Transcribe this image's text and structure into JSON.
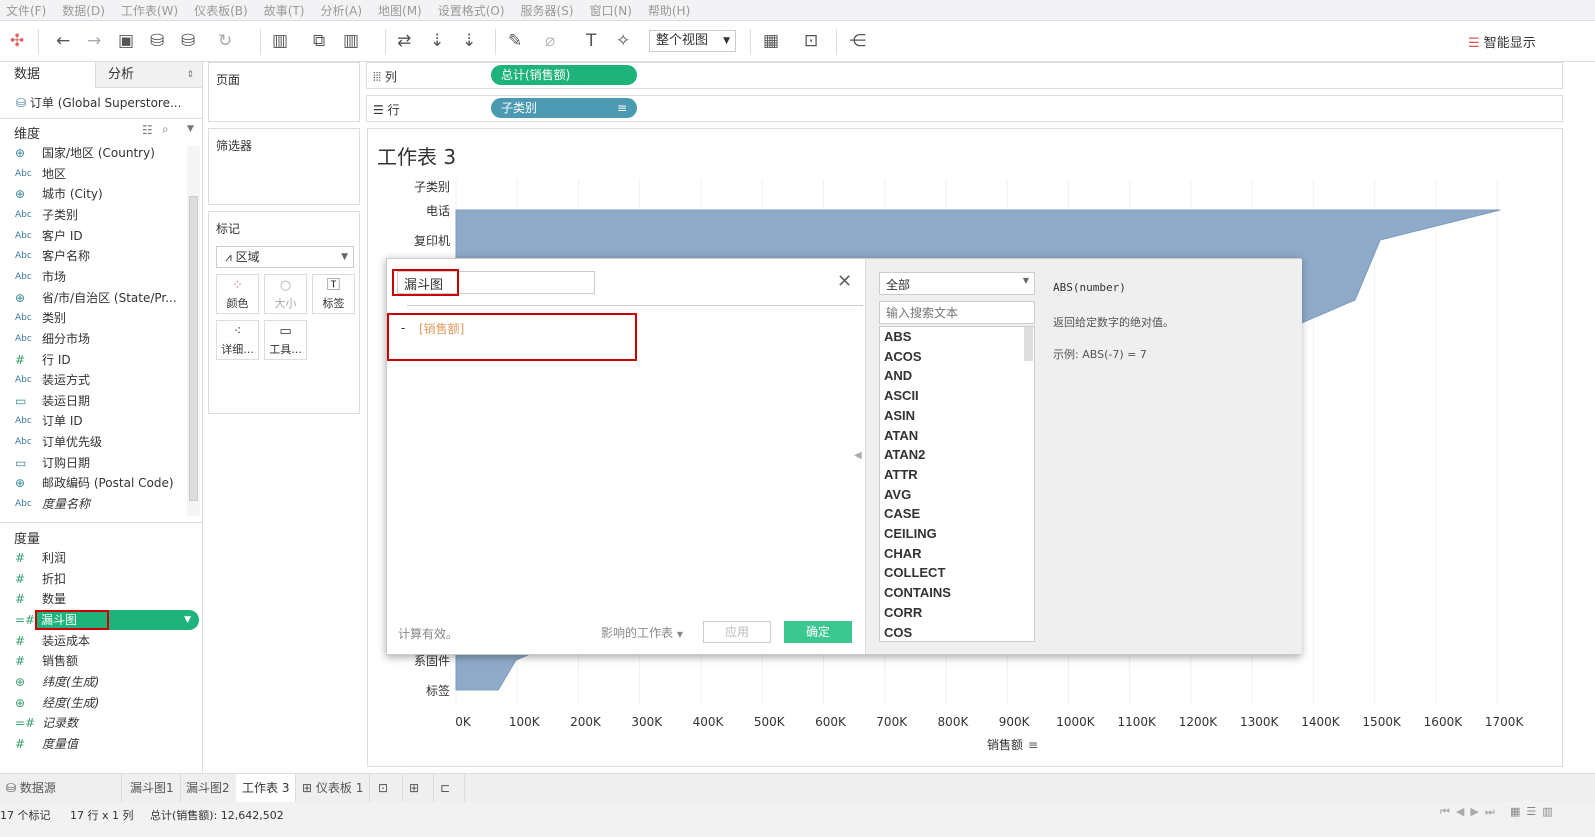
{
  "menu": [
    "文件(F)",
    "数据(D)",
    "工作表(W)",
    "仪表板(B)",
    "故事(T)",
    "分析(A)",
    "地图(M)",
    "设置格式(O)",
    "服务器(S)",
    "窗口(N)",
    "帮助(H)"
  ],
  "toolbar": {
    "fit": "整个视图",
    "show_me": "智能显示"
  },
  "left": {
    "tab_data": "数据",
    "tab_analysis": "分析",
    "datasource": "订单 (Global Superstore...",
    "dimensions_title": "维度",
    "measures_title": "度量",
    "dimensions": [
      {
        "t": "globe",
        "l": "国家/地区 (Country)"
      },
      {
        "t": "Abc",
        "l": "地区"
      },
      {
        "t": "globe",
        "l": "城市 (City)"
      },
      {
        "t": "Abc",
        "l": "子类别"
      },
      {
        "t": "Abc",
        "l": "客户 ID"
      },
      {
        "t": "Abc",
        "l": "客户名称"
      },
      {
        "t": "Abc",
        "l": "市场"
      },
      {
        "t": "globe",
        "l": "省/市/自治区 (State/Pr..."
      },
      {
        "t": "Abc",
        "l": "类别"
      },
      {
        "t": "Abc",
        "l": "细分市场"
      },
      {
        "t": "#",
        "l": "行 ID"
      },
      {
        "t": "Abc",
        "l": "装运方式"
      },
      {
        "t": "date",
        "l": "装运日期"
      },
      {
        "t": "Abc",
        "l": "订单 ID"
      },
      {
        "t": "Abc",
        "l": "订单优先级"
      },
      {
        "t": "date",
        "l": "订购日期"
      },
      {
        "t": "globe",
        "l": "邮政编码 (Postal Code)"
      },
      {
        "t": "Abc",
        "l": "度量名称",
        "i": true
      }
    ],
    "measures": [
      {
        "t": "#",
        "l": "利润"
      },
      {
        "t": "#",
        "l": "折扣"
      },
      {
        "t": "#",
        "l": "数量"
      },
      {
        "t": "=#",
        "l": "漏斗图",
        "sel": true
      },
      {
        "t": "#",
        "l": "装运成本"
      },
      {
        "t": "#",
        "l": "销售额"
      },
      {
        "t": "globe",
        "l": "纬度(生成)",
        "i": true
      },
      {
        "t": "globe",
        "l": "经度(生成)",
        "i": true
      },
      {
        "t": "=#",
        "l": "记录数",
        "i": true
      },
      {
        "t": "#",
        "l": "度量值",
        "i": true
      }
    ]
  },
  "cards": {
    "pages": "页面",
    "filters": "筛选器",
    "marks": "标记",
    "mark_type": "区域",
    "color": "颜色",
    "size": "大小",
    "label": "标签",
    "detail": "详细...",
    "tooltip": "工具..."
  },
  "shelves": {
    "columns": "列",
    "rows": "行",
    "columns_pill": "总计(销售额)",
    "rows_pill": "子类别"
  },
  "sheet": {
    "title": "工作表 3"
  },
  "chart_data": {
    "type": "area",
    "orientation": "horizontal",
    "row_header": "子类别",
    "xlabel": "销售额",
    "categories": [
      "电话",
      "复印机",
      null,
      null,
      null,
      null,
      null,
      null,
      null,
      null,
      null,
      null,
      null,
      null,
      null,
      "系固件",
      "标签"
    ],
    "values": [
      1705000,
      1509000,
      null,
      1468000,
      null,
      null,
      null,
      null,
      null,
      null,
      null,
      null,
      null,
      null,
      null,
      98000,
      69000
    ],
    "xlim": [
      0,
      1770000
    ],
    "xticks": [
      "0K",
      "100K",
      "200K",
      "300K",
      "400K",
      "500K",
      "600K",
      "700K",
      "800K",
      "900K",
      "1000K",
      "1100K",
      "1200K",
      "1300K",
      "1400K",
      "1500K",
      "1600K",
      "1700K"
    ],
    "grid": true,
    "color": "#8eaac8"
  },
  "dialog": {
    "name": "漏斗图",
    "formula_op": "-",
    "formula_field": "[销售额]",
    "status": "计算有效。",
    "affected": "影响的工作表",
    "apply": "应用",
    "ok": "确定",
    "category": "全部",
    "search_placeholder": "输入搜索文本",
    "functions": [
      "ABS",
      "ACOS",
      "AND",
      "ASCII",
      "ASIN",
      "ATAN",
      "ATAN2",
      "ATTR",
      "AVG",
      "CASE",
      "CEILING",
      "CHAR",
      "COLLECT",
      "CONTAINS",
      "CORR",
      "COS"
    ],
    "desc_sig": "ABS(number)",
    "desc_text": "返回给定数字的绝对值。",
    "desc_example": "示例: ABS(-7) = 7"
  },
  "tabs": {
    "datasource": "数据源",
    "sheets": [
      "漏斗图1",
      "漏斗图2",
      "工作表 3"
    ],
    "dashboard": "仪表板 1"
  },
  "status": {
    "marks": "17 个标记",
    "dims": "17 行 x 1 列",
    "total": "总计(销售额): 12,642,502"
  },
  "colors": {
    "green_pill": "#1db37a",
    "blue_pill": "#4b9ab2",
    "ok": "#3cc791",
    "highlight_box": "#cc0000"
  }
}
